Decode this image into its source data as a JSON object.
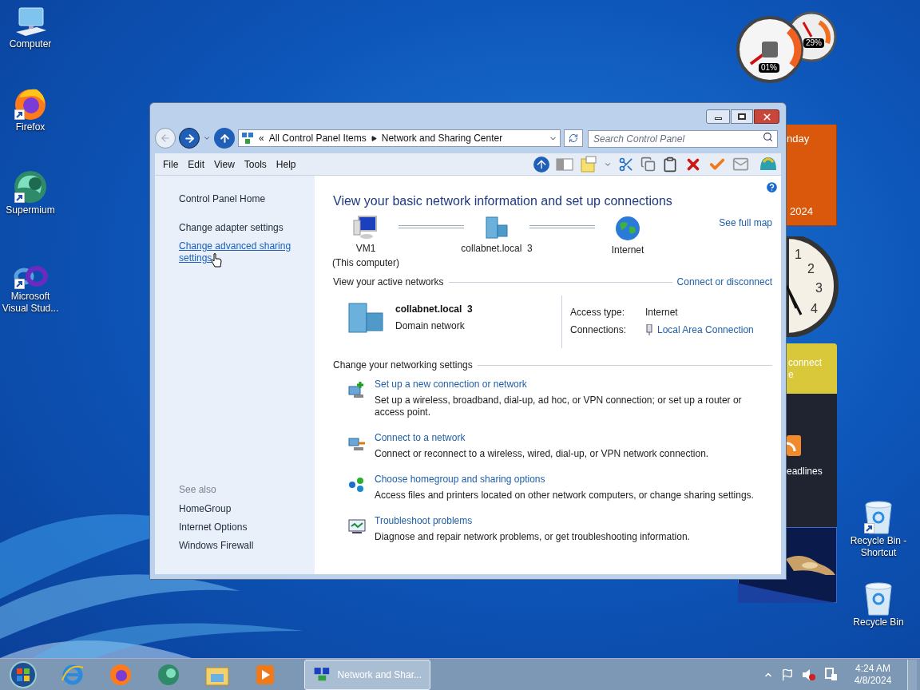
{
  "desktop_icons": [
    {
      "kind": "computer",
      "label": "Computer",
      "shortcut": false
    },
    {
      "kind": "firefox",
      "label": "Firefox",
      "shortcut": true
    },
    {
      "kind": "supermium",
      "label": "Supermium",
      "shortcut": true
    },
    {
      "kind": "vs",
      "label": "Microsoft Visual Stud...",
      "shortcut": true
    }
  ],
  "right_icons": [
    {
      "kind": "recycle",
      "label": "Recycle Bin - Shortcut",
      "shortcut": true
    },
    {
      "kind": "recycle",
      "label": "Recycle Bin",
      "shortcut": false
    }
  ],
  "gadgets": {
    "cpu_meter": {
      "cpu": "01%",
      "memory": "29%"
    },
    "calendar": {
      "weekday": "nday",
      "year": "2024"
    },
    "clock": {
      "numbers": [
        "1",
        "2",
        "3",
        "4"
      ]
    },
    "weather": {
      "lines": [
        "connect",
        "e"
      ]
    },
    "feed": {
      "text": "eadlines"
    }
  },
  "window": {
    "address": {
      "overflow": "«",
      "path": [
        "All Control Panel Items",
        "Network and Sharing Center"
      ]
    },
    "search": {
      "placeholder": "Search Control Panel"
    },
    "menu": [
      "File",
      "Edit",
      "View",
      "Tools",
      "Help"
    ],
    "sidebar": {
      "items": [
        {
          "label": "Control Panel Home",
          "hovered": false
        },
        {
          "label": "Change adapter settings",
          "hovered": false
        },
        {
          "label": "Change advanced sharing settings",
          "hovered": true
        }
      ],
      "see_also": {
        "title": "See also",
        "items": [
          "HomeGroup",
          "Internet Options",
          "Windows Firewall"
        ]
      }
    },
    "main": {
      "heading": "View your basic network information and set up connections",
      "map": {
        "nodes": [
          {
            "kind": "computer",
            "label": "VM1",
            "sublabel": "(This computer)"
          },
          {
            "kind": "network",
            "label": "collabnet.local  3"
          },
          {
            "kind": "internet",
            "label": "Internet"
          }
        ],
        "link": "See full map"
      },
      "active": {
        "title": "View your active networks",
        "link": "Connect or disconnect",
        "name": "collabnet.local  3",
        "type": "Domain network",
        "fields": [
          {
            "label": "Access type:",
            "value": "Internet",
            "kind": "text"
          },
          {
            "label": "Connections:",
            "value": "Local Area Connection",
            "kind": "link"
          }
        ]
      },
      "settings": {
        "title": "Change your networking settings",
        "tasks": [
          {
            "kind": "new",
            "title": "Set up a new connection or network",
            "description": "Set up a wireless, broadband, dial-up, ad hoc, or VPN connection; or set up a router or access point."
          },
          {
            "kind": "connect",
            "title": "Connect to a network",
            "description": "Connect or reconnect to a wireless, wired, dial-up, or VPN network connection."
          },
          {
            "kind": "homegroup",
            "title": "Choose homegroup and sharing options",
            "description": "Access files and printers located on other network computers, or change sharing settings."
          },
          {
            "kind": "troubleshoot",
            "title": "Troubleshoot problems",
            "description": "Diagnose and repair network problems, or get troubleshooting information."
          }
        ]
      }
    }
  },
  "taskbar": {
    "window_button": {
      "label": "Network and Shar...",
      "selected": true
    },
    "time": "4:24 AM",
    "date": "4/8/2024"
  }
}
